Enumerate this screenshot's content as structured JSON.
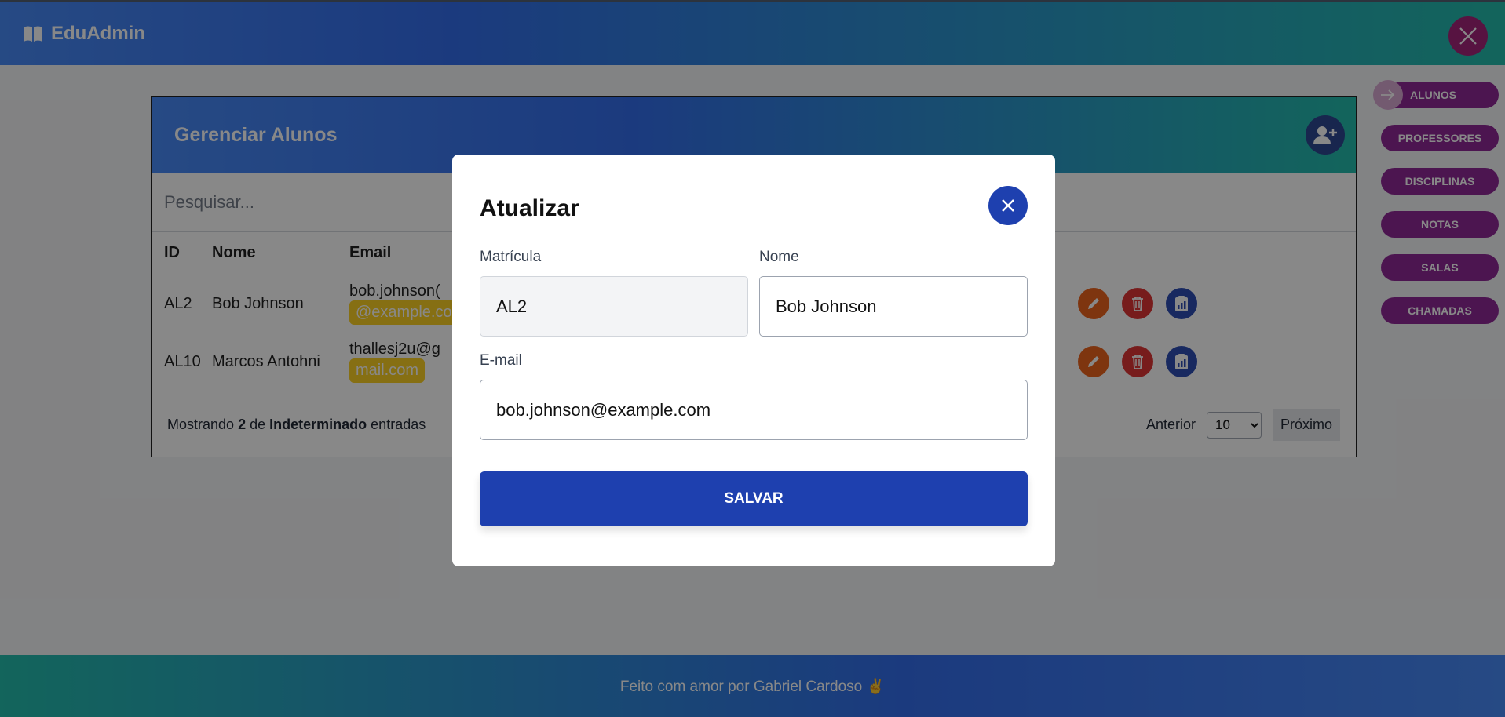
{
  "app": {
    "brand": "EduAdmin"
  },
  "sidenav": {
    "items": [
      {
        "label": "ALUNOS",
        "active": true
      },
      {
        "label": "PROFESSORES"
      },
      {
        "label": "DISCIPLINAS"
      },
      {
        "label": "NOTAS"
      },
      {
        "label": "SALAS"
      },
      {
        "label": "CHAMADAS"
      }
    ]
  },
  "card": {
    "title": "Gerenciar Alunos",
    "search_placeholder": "Pesquisar...",
    "columns": [
      "ID",
      "Nome",
      "Email"
    ],
    "rows": [
      {
        "id": "AL2",
        "name": "Bob Johnson",
        "email_prefix": "bob.johnson(",
        "email_badge": "@example.com"
      },
      {
        "id": "AL10",
        "name": "Marcos Antohni",
        "email_prefix": "thallesj2u@g",
        "email_badge": "mail.com"
      }
    ],
    "footer": {
      "showing_prefix": "Mostrando",
      "count": "2",
      "of": "de",
      "total": "Indeterminado",
      "suffix": "entradas"
    },
    "pager": {
      "prev": "Anterior",
      "page_size": "10",
      "next": "Próximo"
    }
  },
  "modal": {
    "title": "Atualizar",
    "fields": {
      "matricula": {
        "label": "Matrícula",
        "value": "AL2"
      },
      "nome": {
        "label": "Nome",
        "value": "Bob Johnson"
      },
      "email": {
        "label": "E-mail",
        "value": "bob.johnson@example.com"
      }
    },
    "save_label": "SALVAR"
  },
  "footer": {
    "text": "Feito com amor por Gabriel Cardoso ✌️"
  },
  "colors": {
    "primary": "#1e40af",
    "accent_nav": "#86198f",
    "badge": "#facc15"
  }
}
